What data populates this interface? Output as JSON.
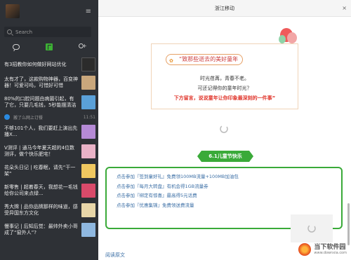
{
  "sidebar": {
    "search_placeholder": "Search",
    "menu_icon": "≡",
    "items": [
      {
        "text": "有3招教你如何做好网站优化"
      },
      {
        "text": "太有才了，这款购物神器，百变神器！可爱可吗，可惜好可惜"
      },
      {
        "text": "80%的口腔问题由病菌引起，有了它，只要几毛钱，5秒能摆清洁"
      },
      {
        "text": "不够101个人，我们要赶上演出先播X..."
      },
      {
        "text": "V测评 | 通马今年夏天超的4位数测评，做个快乐肥宅！"
      },
      {
        "text": "花朵头日记 | 吃春眠，请先“干一架”"
      },
      {
        "text": "新零售 | 超着春天，我想花一毛钱给你公司来点绿..."
      },
      {
        "text": "秀大牌 | 品你品牌那样的味道，感受异国东方文化"
      },
      {
        "text": "慢事记 | 后知后觉：最帅外卖小哥成了“窗外人”?"
      }
    ],
    "sub_row": {
      "text": "搬了么网上订餐",
      "time": "11:51"
    }
  },
  "main": {
    "window_title": "浙江移动",
    "close_label": "×",
    "card": {
      "title": "“致那些逝去的美好童年",
      "line1": "时光荏苒，青春不老。",
      "line2": "可还记得你的童年时光？",
      "line3": "下方留言，说说童年让你印象最深刻的一件事”"
    },
    "banner": "6.1儿童节快乐",
    "rows": [
      "点击参加『签到童好礼』免费领100MB流量+100MB加油包",
      "点击参加『每月大转盘』有机会得1GB流量券",
      "点击参加『绑定有惊喜』最高得5元话费",
      "点击参加『优惠集锦』免费领送费流量"
    ],
    "read_more": "阅读原文"
  },
  "watermark": {
    "text": "当下软件园",
    "url": "www.downxia.com"
  },
  "colors": {
    "sidebar_bg": "#2e3136",
    "accent_green": "#3aaa39",
    "link_blue": "#3a6ea5",
    "highlight_red": "#e0352b"
  }
}
